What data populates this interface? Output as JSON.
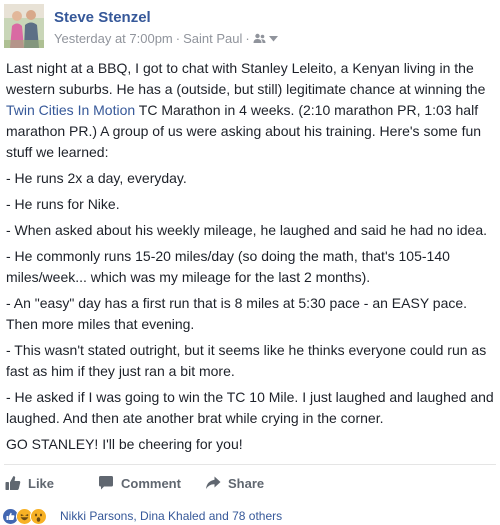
{
  "header": {
    "author": "Steve Stenzel",
    "timestamp": "Yesterday at 7:00pm",
    "separator": "·",
    "location": "Saint Paul",
    "privacy_icon": "friends-icon",
    "chevron_icon": "chevron-down-icon"
  },
  "body": {
    "p1_before_link": "Last night at a BBQ, I got to chat with Stanley Leleito, a Kenyan living in the western suburbs. He has a (outside, but still) legitimate chance at winning the ",
    "p1_link": "Twin Cities In Motion",
    "p1_after_link": " TC Marathon in 4 weeks. (2:10 marathon PR, 1:03 half marathon PR.) A group of us were asking about his training. Here's some fun stuff we learned:",
    "p2": "- He runs 2x a day, everyday.",
    "p3": "- He runs for Nike.",
    "p4": "- When asked about his weekly mileage, he laughed and said he had no idea.",
    "p5": "- He commonly runs 15-20 miles/day (so doing the math, that's 105-140 miles/week... which was my mileage for the last 2 months).",
    "p6": "- An \"easy\" day has a first run that is 8 miles at 5:30 pace - an EASY pace. Then more miles that evening.",
    "p7": "- This wasn't stated outright, but it seems like he thinks everyone could run as fast as him if they just ran a bit more.",
    "p8": "- He asked if I was going to win the TC 10 Mile. I just laughed and laughed and laughed. And then ate another brat while crying in the corner.",
    "p9": "GO STANLEY! I'll be cheering for you!"
  },
  "actions": {
    "like": "Like",
    "comment": "Comment",
    "share": "Share"
  },
  "reactions": {
    "icons": [
      "like-reaction-icon",
      "haha-reaction-icon",
      "wow-reaction-icon"
    ],
    "text": "Nikki Parsons, Dina Khaled and 78 others"
  },
  "colors": {
    "link": "#365899",
    "meta": "#90949c",
    "text": "#1d2129",
    "action": "#606770"
  }
}
